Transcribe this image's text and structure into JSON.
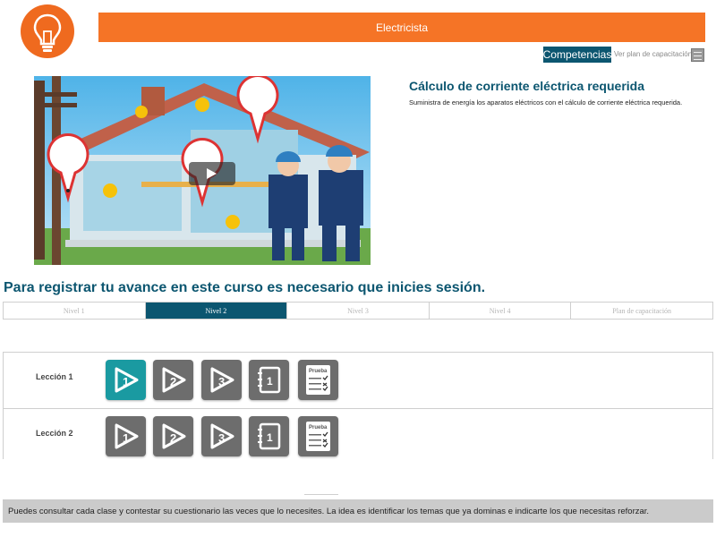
{
  "header": {
    "banner_title": "Electricista",
    "logo_icon": "lightbulb-icon"
  },
  "actions": {
    "competencias_label": "Competencias",
    "plan_link": "Ver plan de capacitación",
    "plan_icon": "list-icon"
  },
  "course": {
    "title": "Cálculo de corriente eléctrica requerida",
    "description": "Suministra de energía los aparatos eléctricos con el cálculo de corriente eléctrica requerida.",
    "video_icon": "play-icon"
  },
  "notice": "Para registrar tu avance en este curso es necesario que inicies sesión.",
  "tabs": [
    {
      "label": "Nivel 1",
      "active": false
    },
    {
      "label": "Nivel 2",
      "active": true
    },
    {
      "label": "Nivel 3",
      "active": false
    },
    {
      "label": "Nivel 4",
      "active": false
    },
    {
      "label": "Plan de capacitación",
      "active": false
    }
  ],
  "lessons": [
    {
      "label": "Lección 1",
      "buttons": [
        "1",
        "2",
        "3"
      ],
      "exam_label": "Prueba",
      "notebook_label": "1"
    },
    {
      "label": "Lección 2",
      "buttons": [
        "1",
        "2",
        "3"
      ],
      "exam_label": "Prueba",
      "notebook_label": "1"
    }
  ],
  "footer": "Puedes consultar cada clase y contestar su cuestionario las veces que lo necesites. La idea es identificar los temas que ya dominas e indicarte los que necesitas reforzar.",
  "colors": {
    "accent_orange": "#f57426",
    "brand_blue": "#0c5670",
    "teal": "#1a9aa1",
    "grey_button": "#6d6d6d"
  }
}
